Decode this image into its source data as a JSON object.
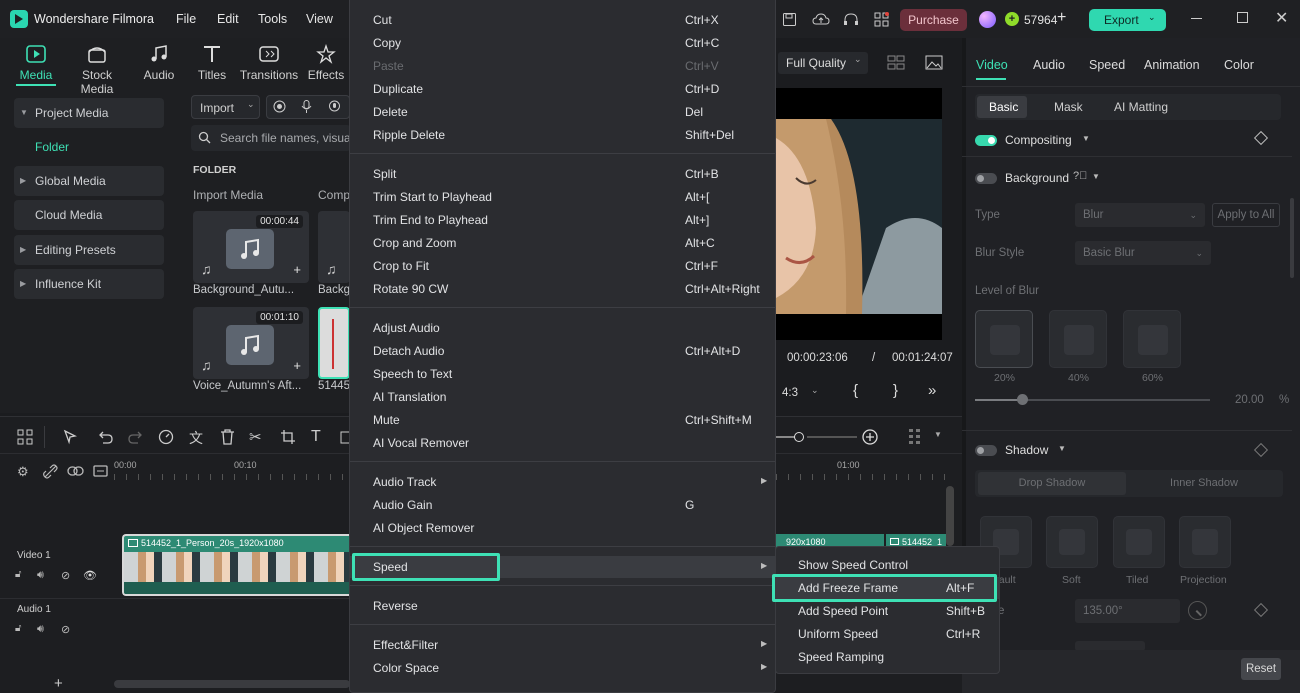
{
  "app": {
    "title": "Wondershare Filmora"
  },
  "topmenu": [
    "File",
    "Edit",
    "Tools",
    "View"
  ],
  "header": {
    "purchase_label": "Purchase",
    "credits": "57964",
    "export_label": "Export"
  },
  "media_tabs": [
    "Media",
    "Stock Media",
    "Audio",
    "Titles",
    "Transitions",
    "Effects"
  ],
  "sidebar": {
    "items": [
      {
        "label": "Project Media",
        "arrow": true
      },
      {
        "label": "Folder",
        "arrow": false
      },
      {
        "label": "Global Media",
        "arrow": true
      },
      {
        "label": "Cloud Media",
        "arrow": false
      },
      {
        "label": "Editing Presets",
        "arrow": true
      },
      {
        "label": "Influence Kit",
        "arrow": true
      }
    ]
  },
  "media": {
    "import_label": "Import",
    "search_placeholder": "Search file names, visuals,",
    "folder_heading": "FOLDER",
    "col_import": "Import Media",
    "col_comp": "Comp",
    "items": [
      {
        "name": "Background_Autu...",
        "duration": "00:00:44"
      },
      {
        "name": "Backgr",
        "duration": ""
      },
      {
        "name": "Voice_Autumn's Aft...",
        "duration": "00:01:10"
      },
      {
        "name": "514452",
        "duration": ""
      }
    ]
  },
  "preview": {
    "quality": "Full Quality",
    "current_time": "00:00:23:06",
    "separator": "/",
    "total_time": "00:01:24:07",
    "ratio": "4:3"
  },
  "timeline": {
    "ruler": [
      "00:00",
      "00:10",
      "01:00"
    ],
    "video_track_label": "Video 1",
    "audio_track_label": "Audio 1",
    "clip_label": "514452_1_Person_20s_1920x1080",
    "clip_label_right1": "920x1080",
    "clip_label_right2": "514452_1",
    "add_track": "+"
  },
  "context_menu": {
    "groups": [
      [
        {
          "label": "Cut",
          "shortcut": "Ctrl+X",
          "disabled": false
        },
        {
          "label": "Copy",
          "shortcut": "Ctrl+C",
          "disabled": false
        },
        {
          "label": "Paste",
          "shortcut": "Ctrl+V",
          "disabled": true
        },
        {
          "label": "Duplicate",
          "shortcut": "Ctrl+D",
          "disabled": false
        },
        {
          "label": "Delete",
          "shortcut": "Del",
          "disabled": false
        },
        {
          "label": "Ripple Delete",
          "shortcut": "Shift+Del",
          "disabled": false
        }
      ],
      [
        {
          "label": "Split",
          "shortcut": "Ctrl+B"
        },
        {
          "label": "Trim Start to Playhead",
          "shortcut": "Alt+["
        },
        {
          "label": "Trim End to Playhead",
          "shortcut": "Alt+]"
        },
        {
          "label": "Crop and Zoom",
          "shortcut": "Alt+C"
        },
        {
          "label": "Crop to Fit",
          "shortcut": "Ctrl+F"
        },
        {
          "label": "Rotate 90 CW",
          "shortcut": "Ctrl+Alt+Right"
        }
      ],
      [
        {
          "label": "Adjust Audio",
          "shortcut": ""
        },
        {
          "label": "Detach Audio",
          "shortcut": "Ctrl+Alt+D"
        },
        {
          "label": "Speech to Text",
          "shortcut": ""
        },
        {
          "label": "AI Translation",
          "shortcut": ""
        },
        {
          "label": "Mute",
          "shortcut": "Ctrl+Shift+M"
        },
        {
          "label": "AI Vocal Remover",
          "shortcut": ""
        }
      ],
      [
        {
          "label": "Audio Track",
          "shortcut": "",
          "submenu": true
        },
        {
          "label": "Audio Gain",
          "shortcut": "G"
        },
        {
          "label": "AI Object Remover",
          "shortcut": ""
        }
      ],
      [
        {
          "label": "Speed",
          "shortcut": "",
          "submenu": true,
          "highlight": true
        }
      ],
      [
        {
          "label": "Reverse",
          "shortcut": ""
        }
      ],
      [
        {
          "label": "Effect&Filter",
          "shortcut": "",
          "submenu": true
        },
        {
          "label": "Color Space",
          "shortcut": "",
          "submenu": true
        }
      ]
    ]
  },
  "speed_submenu": [
    {
      "label": "Show Speed Control",
      "shortcut": ""
    },
    {
      "label": "Add Freeze Frame",
      "shortcut": "Alt+F",
      "highlight": true
    },
    {
      "label": "Add Speed Point",
      "shortcut": "Shift+B"
    },
    {
      "label": "Uniform Speed",
      "shortcut": "Ctrl+R"
    },
    {
      "label": "Speed Ramping",
      "shortcut": ""
    }
  ],
  "properties": {
    "tabs": [
      "Video",
      "Audio",
      "Speed",
      "Animation",
      "Color"
    ],
    "subtabs": [
      "Basic",
      "Mask",
      "AI Matting"
    ],
    "compositing": "Compositing",
    "background": "Background",
    "type_label": "Type",
    "type_value": "Blur",
    "apply_all": "Apply to All",
    "blur_style_label": "Blur Style",
    "blur_style_value": "Basic Blur",
    "level_label": "Level of Blur",
    "levels": [
      "20%",
      "40%",
      "60%"
    ],
    "level_value": "20.00",
    "level_unit": "%",
    "level_fraction": 0.2,
    "shadow": "Shadow",
    "shadow_tabs": [
      "Drop Shadow",
      "Inner Shadow"
    ],
    "shadow_presets": [
      "efault",
      "Soft",
      "Tiled",
      "Projection"
    ],
    "angle_label": "e",
    "angle_value": "135.00°",
    "reset": "Reset"
  },
  "colors": {
    "accent": "#3ee1b5",
    "purchase": "#6b2f3b",
    "export": "#2fd8b0"
  }
}
